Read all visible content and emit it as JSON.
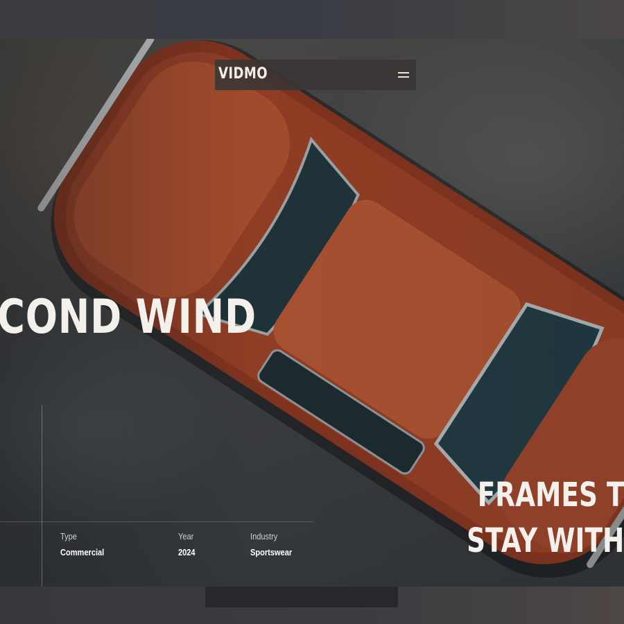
{
  "brand": {
    "logo": "VIDMO"
  },
  "nav": {
    "menu_icon": "hamburger-menu-icon"
  },
  "hero": {
    "title": "COND WIND",
    "tagline_line1": "FRAMES T",
    "tagline_line2": "STAY WITH"
  },
  "details": [
    {
      "label": "Type",
      "value": "Commercial"
    },
    {
      "label": "Year",
      "value": "2024"
    },
    {
      "label": "Industry",
      "value": "Sportswear"
    }
  ],
  "colors": {
    "car_body": "#8a3b22",
    "car_highlight": "#b25a38",
    "glass": "#22353c",
    "nav_bg": "#3a3634",
    "text": "#f2efe9"
  }
}
